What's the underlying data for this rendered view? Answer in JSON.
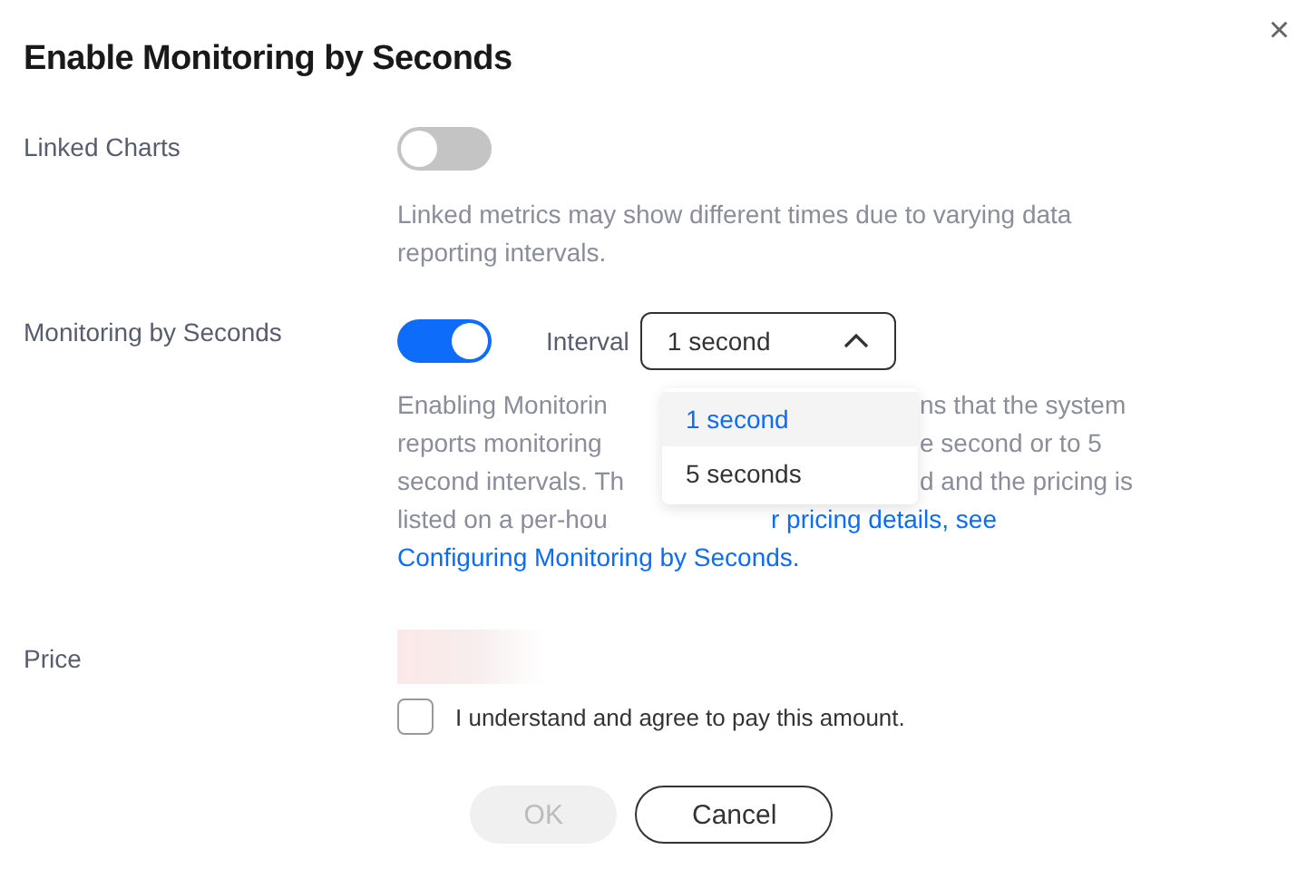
{
  "dialog": {
    "title": "Enable Monitoring by Seconds",
    "close": "×"
  },
  "linked_charts": {
    "label": "Linked Charts",
    "on": false,
    "hint": "Linked metrics may show different times due to varying data reporting intervals."
  },
  "monitoring": {
    "label": "Monitoring by Seconds",
    "on": true,
    "interval_label": "Interval",
    "interval_value": "1 second",
    "expanded": true,
    "options": [
      {
        "label": "1 second",
        "selected": true
      },
      {
        "label": "5 seconds",
        "selected": false
      }
    ],
    "description_lines": [
      {
        "kind": "covered",
        "left": "Enabling Monitorin",
        "right": "ns that the system"
      },
      {
        "kind": "covered",
        "left": "reports monitoring",
        "right": "e second or to 5"
      },
      {
        "kind": "covered",
        "left": "second intervals. Th",
        "right": "d and the pricing is"
      },
      {
        "kind": "edge",
        "left": "listed on a per-hou",
        "right": "r pricing details, see"
      },
      {
        "kind": "link",
        "left": "Configuring Monitoring by Seconds."
      }
    ]
  },
  "price": {
    "label": "Price",
    "agree_text": "I understand and agree to pay this amount.",
    "agreed": false
  },
  "buttons": {
    "ok": {
      "label": "OK",
      "disabled": true
    },
    "cancel": {
      "label": "Cancel"
    }
  }
}
